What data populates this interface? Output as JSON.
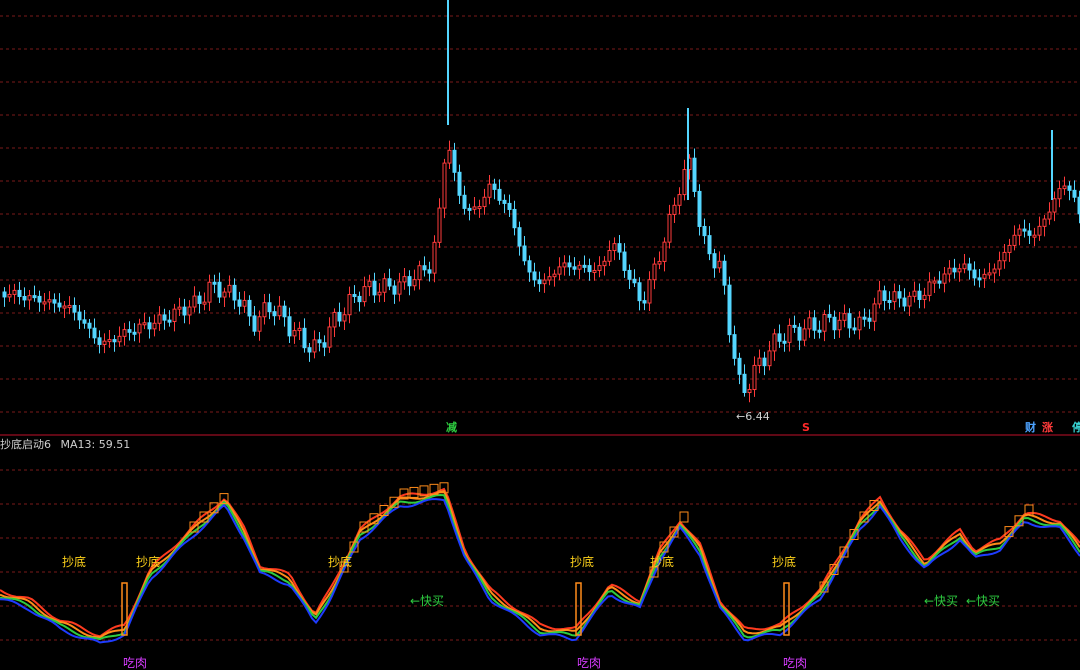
{
  "chart_data": [
    {
      "type": "candlestick",
      "panel": "price",
      "up_color": "#ff3b3b",
      "down_color": "#54d6ff",
      "grid": "dashed horizontal red",
      "low_marker": {
        "text": "←6.44",
        "value": 6.44
      },
      "event_tags": [
        {
          "text": "减",
          "color": "#2ecc40"
        },
        {
          "text": "S",
          "color": "#ff2a2a"
        },
        {
          "text": "财",
          "color": "#4da3ff"
        },
        {
          "text": "涨",
          "color": "#ff3b3b"
        },
        {
          "text": "停",
          "color": "#38d5d5"
        }
      ]
    },
    {
      "type": "line",
      "panel": "indicator",
      "title": "抄底启动6",
      "ma_label": "MA13: 59.51",
      "series_colors": [
        "#ff3b1f",
        "#ff8c1a",
        "#2ecc40",
        "#1e3cff"
      ],
      "labels": {
        "buy_bottom": "抄底",
        "fast_buy": "←快买",
        "loss": "吃肉"
      }
    }
  ],
  "annotations": {
    "buy_bottom_count": 6,
    "fast_buy_count": 3,
    "loss_count": 3
  }
}
